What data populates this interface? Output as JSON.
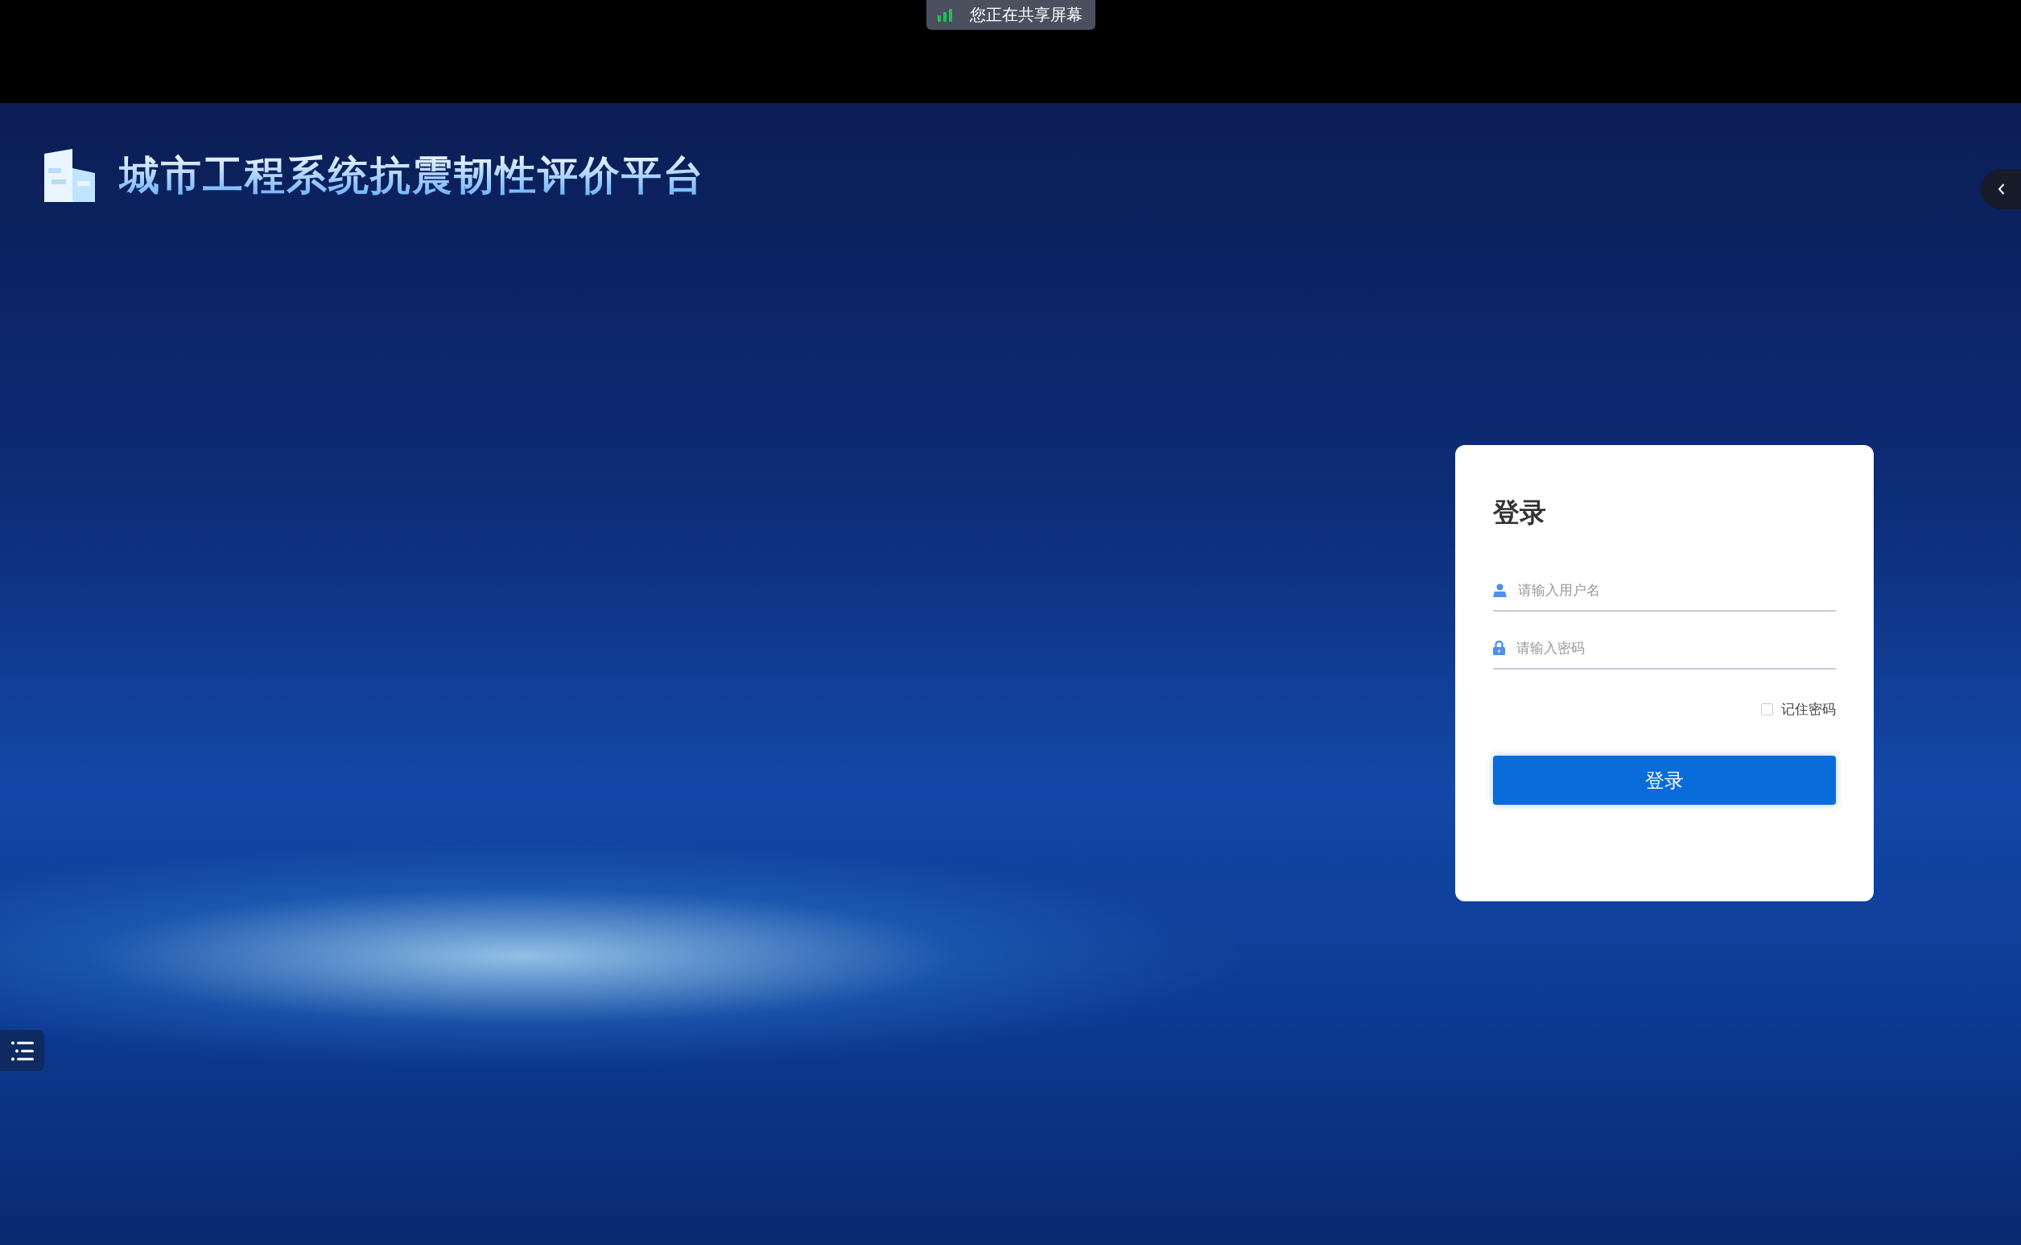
{
  "screen_share_banner": {
    "text": "您正在共享屏幕"
  },
  "header": {
    "title": "城市工程系统抗震韧性评价平台"
  },
  "login": {
    "title": "登录",
    "username": {
      "placeholder": "请输入用户名"
    },
    "password": {
      "placeholder": "请输入密码"
    },
    "remember_password": {
      "label": "记住密码",
      "checked": false
    },
    "submit_button": "登录"
  }
}
